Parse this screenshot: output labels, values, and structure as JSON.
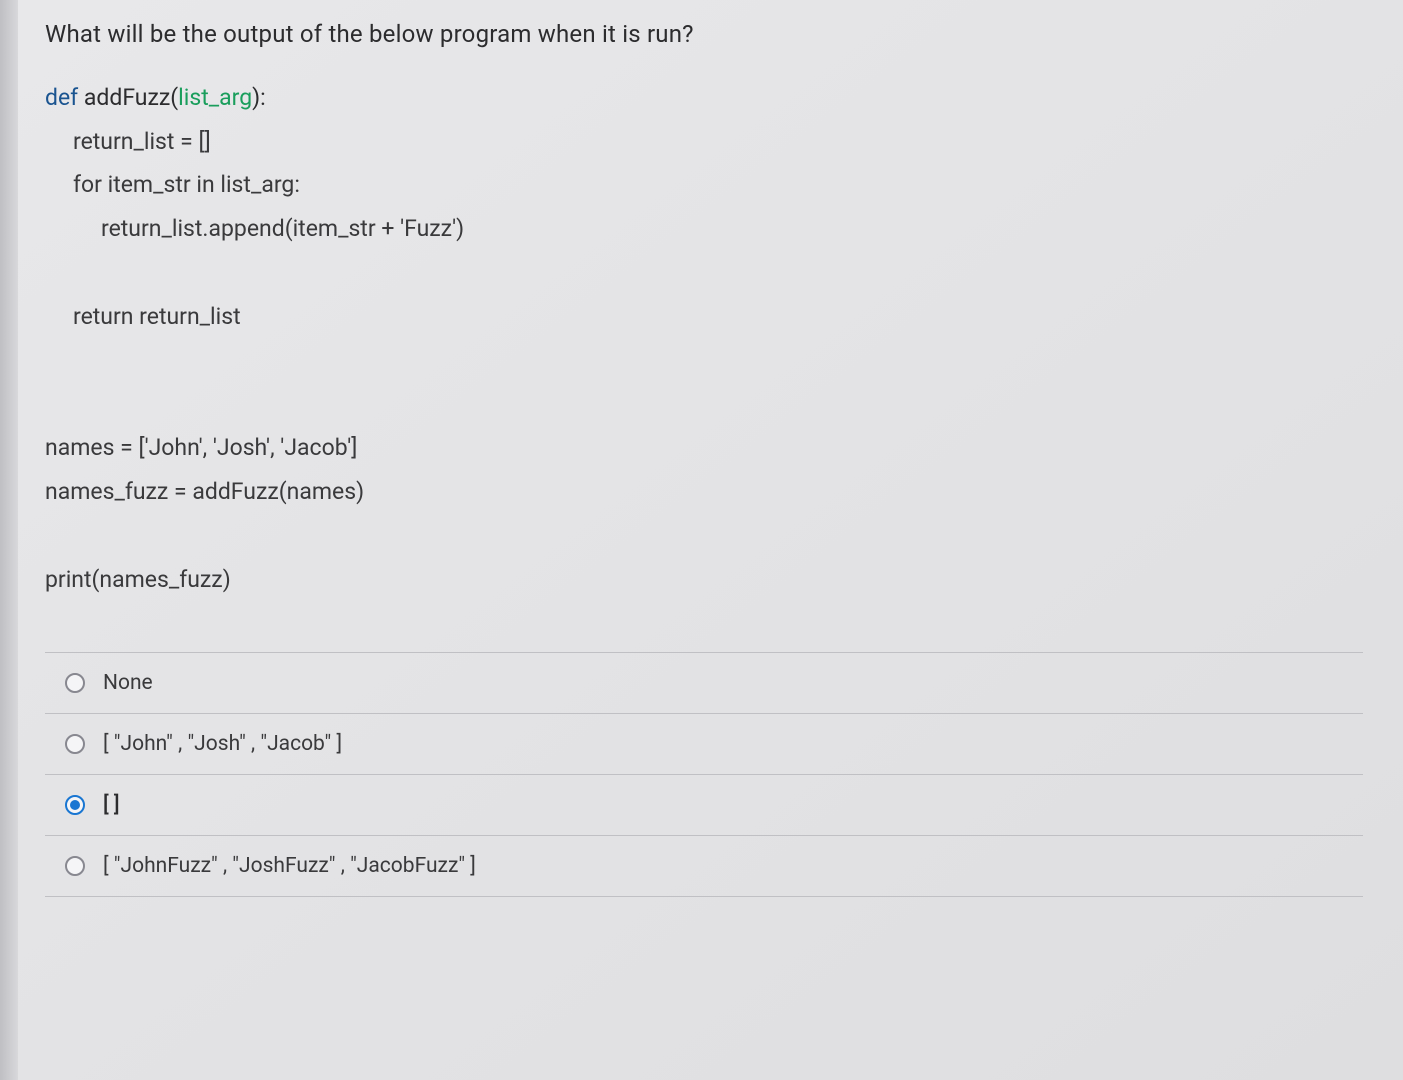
{
  "question": {
    "prompt": "What will be the output of the below program when it is run?"
  },
  "code": {
    "line1_def": "def",
    "line1_fn": " addFuzz(",
    "line1_param": "list_arg",
    "line1_close": "):",
    "line2": "return_list = []",
    "line3": "for item_str in list_arg:",
    "line4": "return_list.append(item_str + 'Fuzz')",
    "line5": "return return_list",
    "line6": "names = ['John', 'Josh', 'Jacob']",
    "line7": "names_fuzz = addFuzz(names)",
    "line8": "print(names_fuzz)"
  },
  "options": [
    {
      "label": "None",
      "selected": false
    },
    {
      "label": "[ \"John\" , \"Josh\" , \"Jacob\" ]",
      "selected": false
    },
    {
      "label": "[ ]",
      "selected": true
    },
    {
      "label": "[ \"JohnFuzz\" , \"JoshFuzz\" , \"JacobFuzz\" ]",
      "selected": false
    }
  ]
}
